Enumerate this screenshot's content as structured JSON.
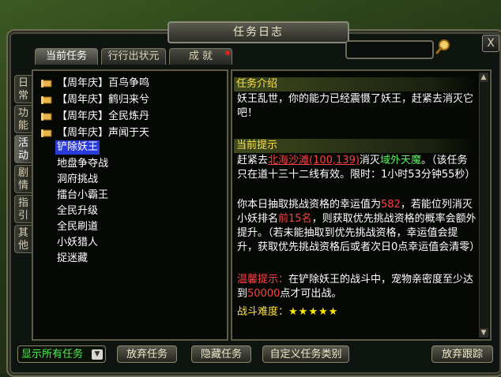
{
  "window": {
    "title": "任务日志",
    "close_label": "X"
  },
  "tabs": [
    {
      "label": "当前任务"
    },
    {
      "label": "行行出状元"
    },
    {
      "label": "成 就"
    }
  ],
  "side_tabs": [
    {
      "label": "日常"
    },
    {
      "label": "功能"
    },
    {
      "label": "活动"
    },
    {
      "label": "剧情"
    },
    {
      "label": "指引"
    },
    {
      "label": "其他"
    }
  ],
  "quest_list": [
    "【周年庆】百鸟争鸣",
    "【周年庆】鹤归来兮",
    "【周年庆】全民炼丹",
    "【周年庆】声闻于天",
    "铲除妖王",
    "地盘争夺战",
    "洞府挑战",
    "擂台小霸王",
    "全民升级",
    "全民刷道",
    "小妖猎人",
    "捉迷藏"
  ],
  "detail": {
    "intro_heading": "任务介绍",
    "intro_text": "妖王乱世，你的能力已经震慑了妖王，赶紧去消灭它吧！",
    "tip_heading": "当前提示",
    "tip_p1_a": "赶紧去",
    "tip_p1_link": "北海沙滩(100,139)",
    "tip_p1_b": "消灭",
    "tip_p1_target": "域外天魔",
    "tip_p1_c": "。（该任务只在道十三十二线有效。限时：1小时53分钟55秒）",
    "tip_p2_a": "你本日抽取挑战资格的幸运值为",
    "tip_p2_luck": "582",
    "tip_p2_b": "，若能位列消灭小妖排名",
    "tip_p2_rank": "前15名",
    "tip_p2_c": "，则获取优先挑战资格的概率会额外提升。（若未能抽取到优先挑战资格，幸运值会提升，获取优先挑战资格后或者次日0点幸运值会清零）",
    "tip_p3_label": "温馨提示：",
    "tip_p3_a": "在铲除妖王的战斗中，宠物亲密度至少达到",
    "tip_p3_num": "50000",
    "tip_p3_b": "点才可出战。",
    "difficulty_label": "战斗难度：",
    "difficulty_stars": "★★★★★"
  },
  "bottom": {
    "filter_label": "显示所有任务",
    "abandon_label": "放弃任务",
    "hide_label": "隐藏任务",
    "custom_label": "自定义任务类别",
    "untrack_label": "放弃跟踪"
  },
  "colors": {
    "accent_yellow": "#ffe04a",
    "highlight_red": "#ff4040",
    "selected_bg": "#2a3bd8",
    "filter_green": "#4cf04c"
  }
}
